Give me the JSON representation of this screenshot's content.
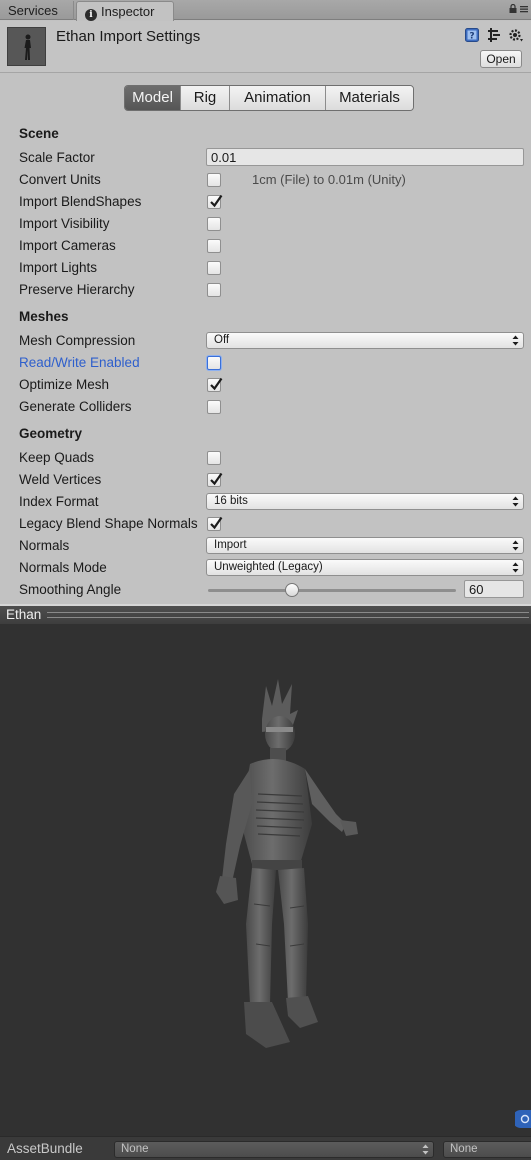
{
  "tabs": {
    "services": "Services",
    "inspector": "Inspector"
  },
  "header": {
    "title": "Ethan Import Settings",
    "open_label": "Open"
  },
  "segments": [
    "Model",
    "Rig",
    "Animation",
    "Materials"
  ],
  "active_segment": "Model",
  "scene": {
    "title": "Scene",
    "scale_factor_label": "Scale Factor",
    "scale_factor_value": "0.01",
    "convert_units_label": "Convert Units",
    "convert_units_hint": "1cm (File) to 0.01m (Unity)",
    "import_blendshapes_label": "Import BlendShapes",
    "import_visibility_label": "Import Visibility",
    "import_cameras_label": "Import Cameras",
    "import_lights_label": "Import Lights",
    "preserve_hierarchy_label": "Preserve Hierarchy"
  },
  "meshes": {
    "title": "Meshes",
    "mesh_compression_label": "Mesh Compression",
    "mesh_compression_value": "Off",
    "read_write_label": "Read/Write Enabled",
    "optimize_mesh_label": "Optimize Mesh",
    "generate_colliders_label": "Generate Colliders"
  },
  "geometry": {
    "title": "Geometry",
    "keep_quads_label": "Keep Quads",
    "weld_vertices_label": "Weld Vertices",
    "index_format_label": "Index Format",
    "index_format_value": "16 bits",
    "legacy_blend_label": "Legacy Blend Shape Normals",
    "normals_label": "Normals",
    "normals_value": "Import",
    "normals_mode_label": "Normals Mode",
    "normals_mode_value": "Unweighted (Legacy)",
    "smoothing_angle_label": "Smoothing Angle",
    "smoothing_angle_value": "60"
  },
  "checkbox_states": {
    "convert_units": false,
    "import_blendshapes": true,
    "import_visibility": false,
    "import_cameras": false,
    "import_lights": false,
    "preserve_hierarchy": false,
    "read_write_enabled": false,
    "optimize_mesh": true,
    "generate_colliders": false,
    "keep_quads": false,
    "weld_vertices": true,
    "legacy_blend_shape_normals": true
  },
  "smoothing_angle_fraction": 0.33,
  "preview": {
    "title": "Ethan"
  },
  "asset_bundle": {
    "label": "AssetBundle",
    "name_value": "None",
    "variant_value": "None"
  },
  "colors": {
    "highlight_label": "#2e5fcc",
    "viewport_bg": "#313131",
    "active_tab": "#606060"
  },
  "icons": [
    "info-icon",
    "lock-icon",
    "menu-icon",
    "help-icon",
    "preset-icon",
    "gear-icon",
    "checkmark-icon",
    "dropdown-arrows-icon",
    "slider-thumb",
    "globe-icon"
  ]
}
